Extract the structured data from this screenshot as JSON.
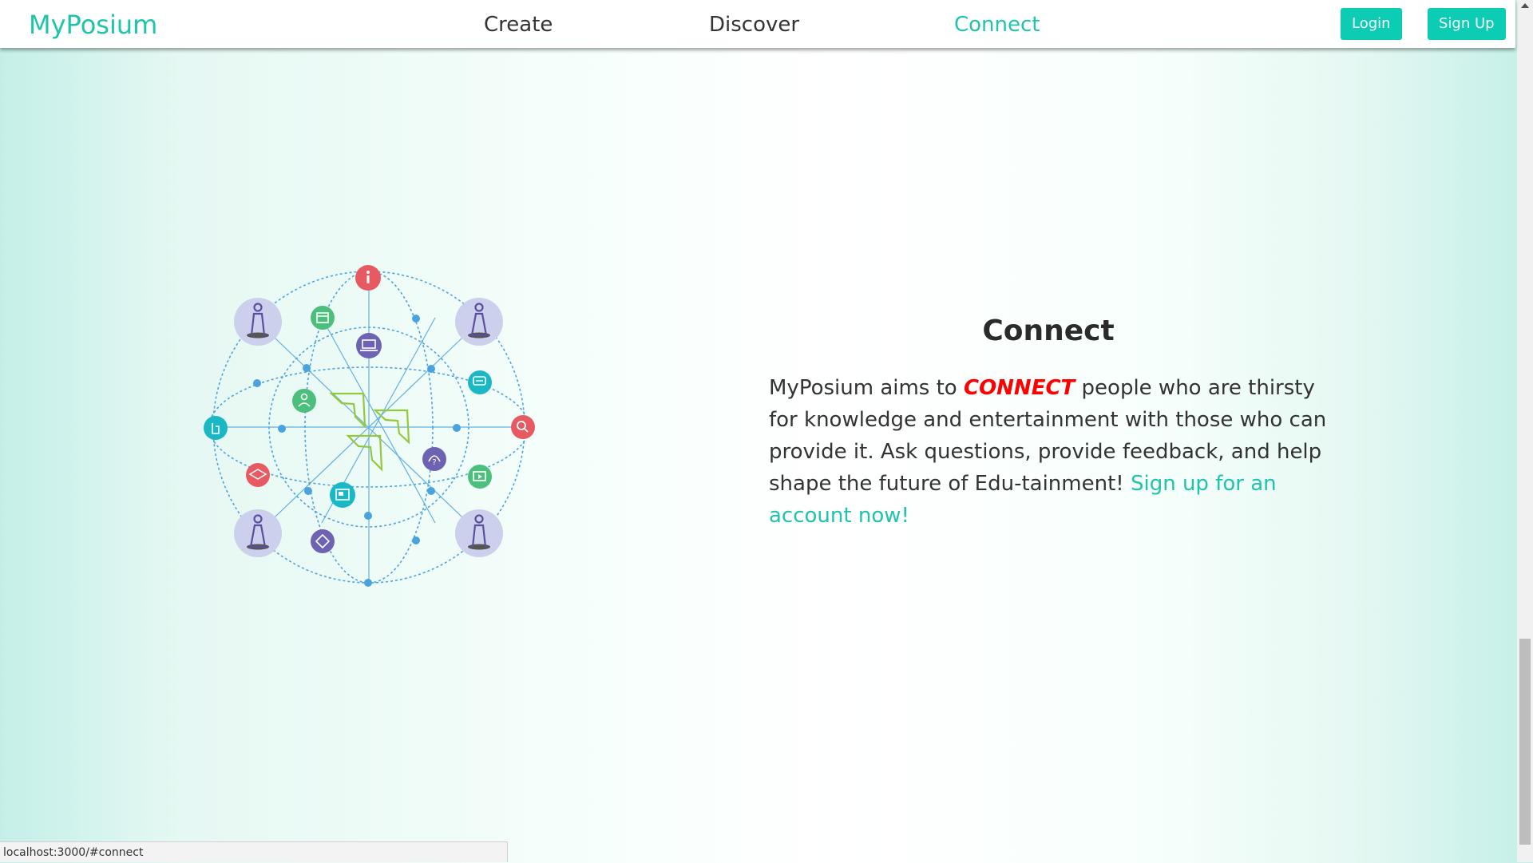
{
  "navbar": {
    "brand": "MyPosium",
    "links": [
      {
        "label": "Create"
      },
      {
        "label": "Discover"
      },
      {
        "label": "Connect",
        "active": true
      }
    ],
    "login_label": "Login",
    "signup_label": "Sign Up"
  },
  "connect_section": {
    "title": "Connect",
    "body_before": "MyPosium aims to ",
    "body_emphasis": "CONNECT",
    "body_after": " people who are thirsty for knowledge and entertainment with those who can provide it. Ask questions, provide feedback, and help shape the future of Edu-tainment! ",
    "cta_link": "Sign up for an account now!"
  },
  "illustration": {
    "icons": [
      "person-icon",
      "calendar-icon",
      "info-icon",
      "laptop-icon",
      "chat-icon",
      "search-icon",
      "touch-icon",
      "teacher-icon",
      "arrow-icon",
      "headset-icon",
      "graduation-cap-icon",
      "video-icon",
      "news-icon",
      "diploma-icon"
    ]
  },
  "status_bar": {
    "url": "localhost:3000/#connect"
  },
  "colors": {
    "brand": "#1fc4aa",
    "button": "#0ccdb4",
    "emphasis": "#ff0000",
    "network_line": "#4aa3df",
    "person_circle": "#cdd0ec",
    "node_red": "#e85a62",
    "node_green": "#4cbf7c",
    "node_purple": "#6e62b3",
    "node_teal": "#19b8c4",
    "arrow_green": "#95c93b"
  }
}
